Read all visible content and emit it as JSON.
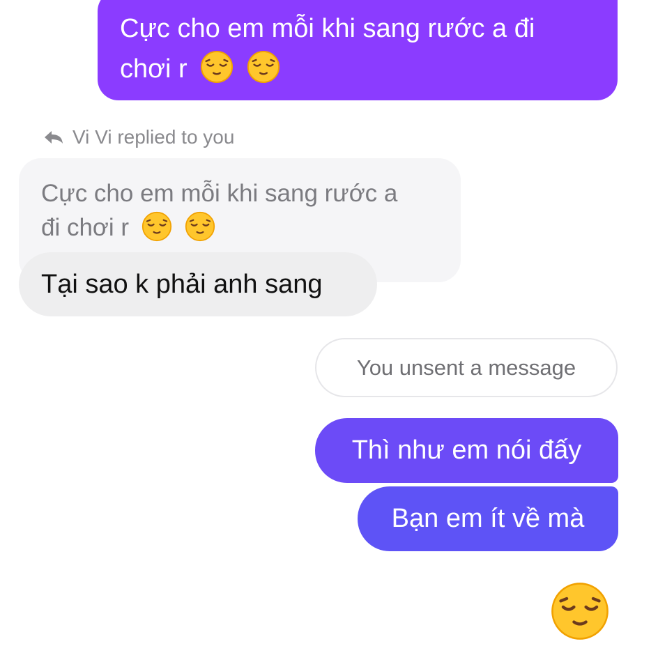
{
  "messages": {
    "sent_top": {
      "line1": "Cực cho em mỗi khi sang rước a đi",
      "line2": "chơi r"
    },
    "reply_indicator": {
      "text": "Vi Vi replied to you",
      "icon": "reply-arrow-icon"
    },
    "quoted": {
      "line1": "Cực cho em mỗi khi sang rước a",
      "line2": "đi chơi r"
    },
    "received": {
      "text": "Tại sao k phải anh sang"
    },
    "unsent": {
      "text": "You unsent a message"
    },
    "sent_a": {
      "text": "Thì như em nói đấy"
    },
    "sent_b": {
      "text": "Bạn em ít về mà"
    }
  },
  "emoji": {
    "name": "relieved-face-emoji",
    "face_color": "#ffc62c",
    "feature_color": "#6b3a1d"
  },
  "colors": {
    "sent_top": "#8b3cff",
    "sent_a": "#6c4bf7",
    "sent_b": "#5e53f6",
    "quoted_bg": "#f5f5f7",
    "received_bg": "#eeeeef"
  }
}
